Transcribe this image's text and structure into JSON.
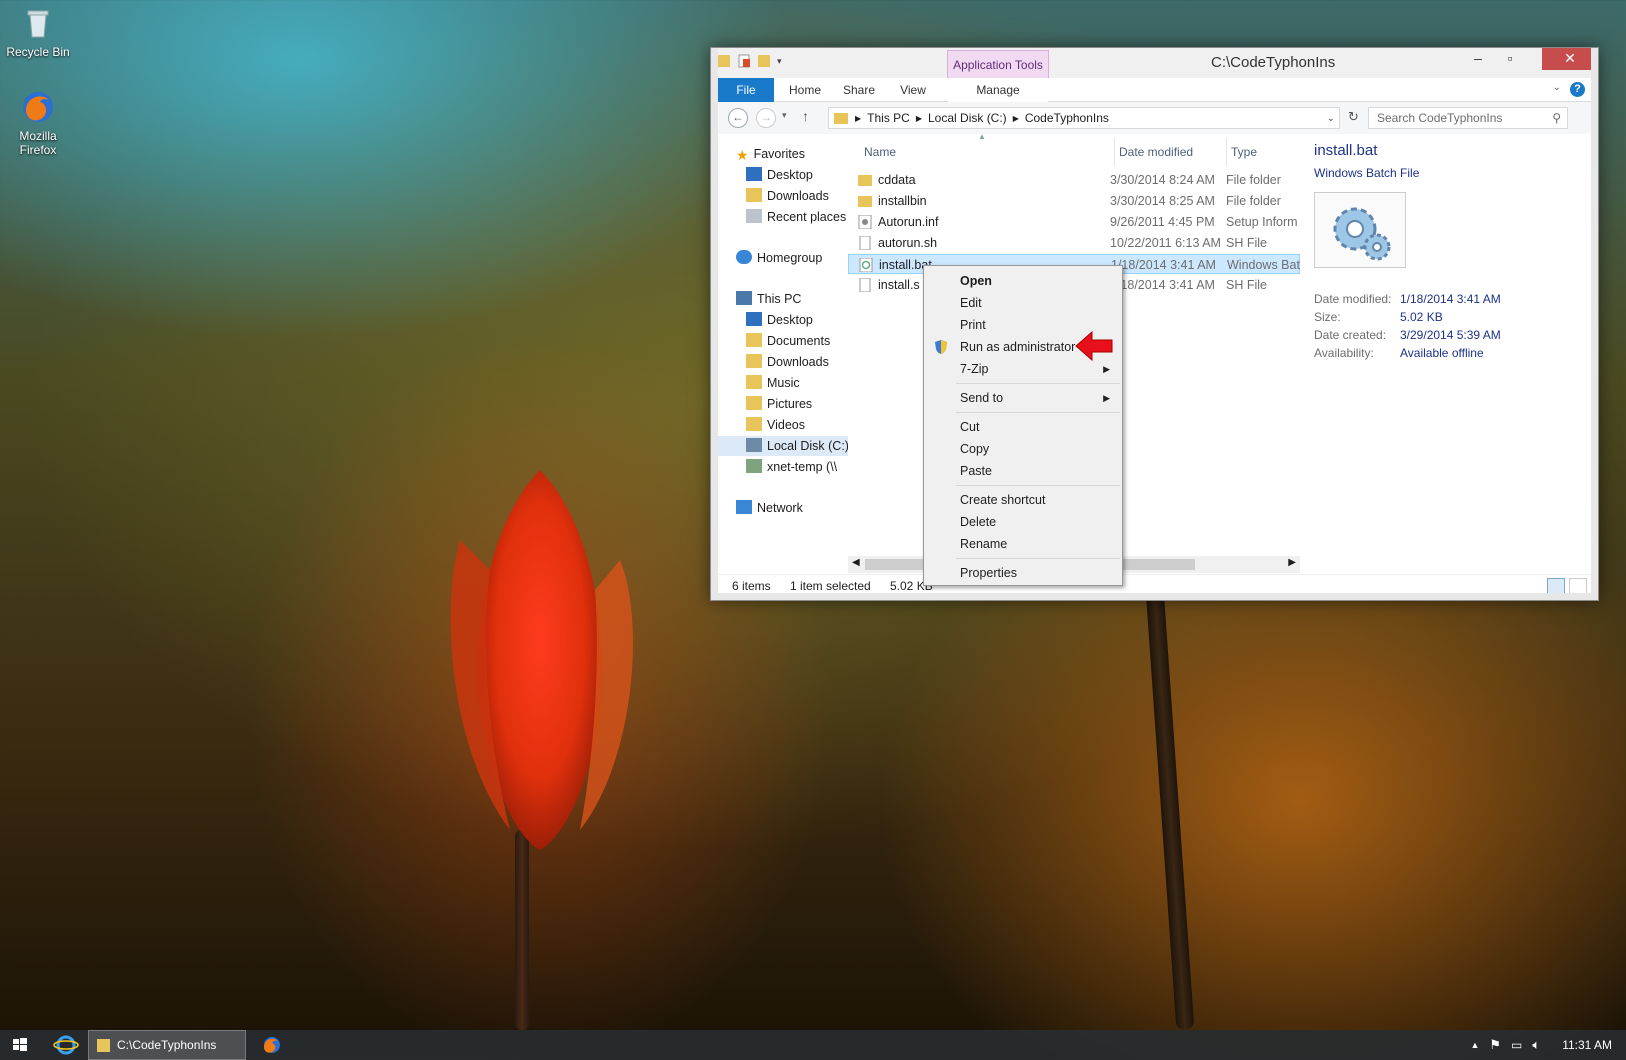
{
  "desktop": {
    "icons": [
      {
        "label": "Recycle Bin"
      },
      {
        "label": "Mozilla Firefox"
      }
    ]
  },
  "window": {
    "title": "C:\\CodeTyphonIns",
    "contextual_tab_group": "Application Tools",
    "ribbon_tabs": [
      "File",
      "Home",
      "Share",
      "View",
      "Manage"
    ],
    "address": {
      "segments": [
        "This PC",
        "Local Disk (C:)",
        "CodeTyphonIns"
      ]
    },
    "search_placeholder": "Search CodeTyphonIns",
    "nav_pane": {
      "favorites": "Favorites",
      "favorites_items": [
        "Desktop",
        "Downloads",
        "Recent places"
      ],
      "homegroup": "Homegroup",
      "this_pc": "This PC",
      "this_pc_items": [
        "Desktop",
        "Documents",
        "Downloads",
        "Music",
        "Pictures",
        "Videos",
        "Local Disk (C:)",
        "xnet-temp (\\\\"
      ],
      "network": "Network"
    },
    "columns": {
      "name": "Name",
      "date": "Date modified",
      "type": "Type"
    },
    "files": [
      {
        "name": "cddata",
        "date": "3/30/2014 8:24 AM",
        "type": "File folder",
        "kind": "folder"
      },
      {
        "name": "installbin",
        "date": "3/30/2014 8:25 AM",
        "type": "File folder",
        "kind": "folder"
      },
      {
        "name": "Autorun.inf",
        "date": "9/26/2011 4:45 PM",
        "type": "Setup Inform",
        "kind": "setup"
      },
      {
        "name": "autorun.sh",
        "date": "10/22/2011 6:13 AM",
        "type": "SH File",
        "kind": "file"
      },
      {
        "name": "install.bat",
        "date": "1/18/2014 3:41 AM",
        "type": "Windows Bat",
        "kind": "bat"
      },
      {
        "name": "install.s",
        "date": "1/18/2014 3:41 AM",
        "type": "SH File",
        "kind": "file"
      }
    ],
    "selected_file_index": 4,
    "preview": {
      "title": "install.bat",
      "subtitle": "Windows Batch File",
      "props": [
        {
          "label": "Date modified:",
          "value": "1/18/2014 3:41 AM"
        },
        {
          "label": "Size:",
          "value": "5.02 KB"
        },
        {
          "label": "Date created:",
          "value": "3/29/2014 5:39 AM"
        },
        {
          "label": "Availability:",
          "value": "Available offline"
        }
      ]
    },
    "status": {
      "items": "6 items",
      "selected": "1 item selected",
      "size": "5.02 KB"
    }
  },
  "context_menu": {
    "items": [
      {
        "label": "Open",
        "bold": true
      },
      {
        "label": "Edit"
      },
      {
        "label": "Print"
      },
      {
        "label": "Run as administrator",
        "icon": "uac-shield-icon"
      },
      {
        "label": "7-Zip",
        "submenu": true
      },
      {
        "label": "Send to",
        "submenu": true
      },
      {
        "label": "Cut"
      },
      {
        "label": "Copy"
      },
      {
        "label": "Paste"
      },
      {
        "label": "Create shortcut"
      },
      {
        "label": "Delete"
      },
      {
        "label": "Rename"
      },
      {
        "label": "Properties"
      }
    ]
  },
  "taskbar": {
    "explorer_label": "C:\\CodeTyphonIns",
    "clock": "11:31 AM"
  },
  "colors": {
    "accent": "#1979ca",
    "annotation_arrow": "#e8101a"
  }
}
